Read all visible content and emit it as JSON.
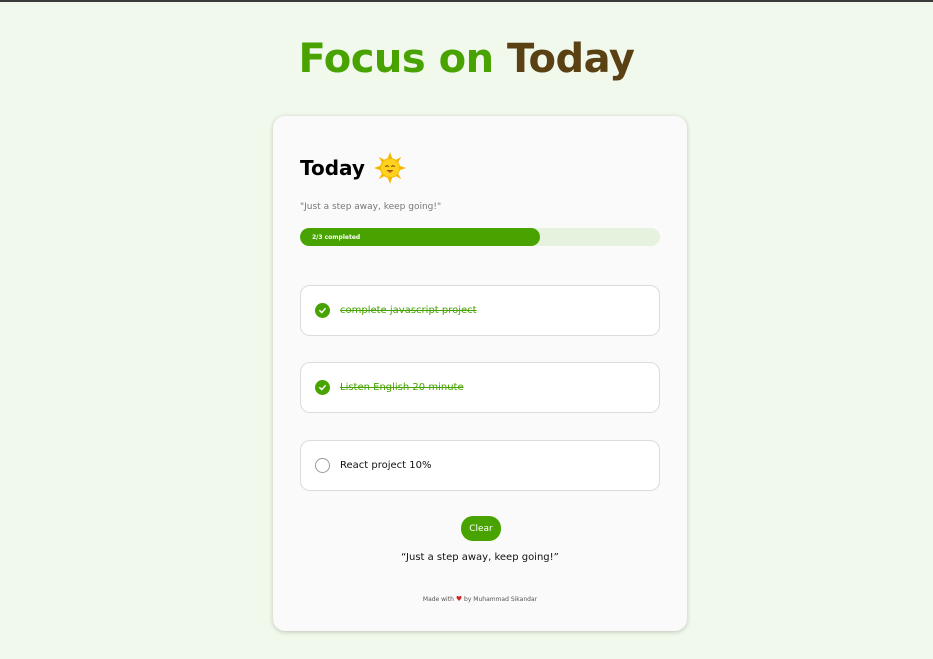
{
  "page": {
    "title_part1": "Focus on",
    "title_part2": "Today"
  },
  "card": {
    "title": "Today",
    "icon": "sun-icon",
    "subtitle": "\"Just a step away, keep going!\"",
    "progress": {
      "label": "2/3 completed",
      "completed": 2,
      "total": 3,
      "fraction": 0.667
    },
    "tasks": [
      {
        "text": "complete javascript project",
        "done": true
      },
      {
        "text": "Listen English 20 minute",
        "done": true
      },
      {
        "text": "React project 10%",
        "done": false
      }
    ],
    "clear_label": "Clear",
    "quote": "“Just a step away, keep going!”",
    "footer": {
      "prefix": "Made with",
      "suffix": "by Muhammad Sikandar"
    }
  },
  "colors": {
    "accent": "#48a300",
    "brown": "#5a4113",
    "background": "#f1f9ec"
  }
}
